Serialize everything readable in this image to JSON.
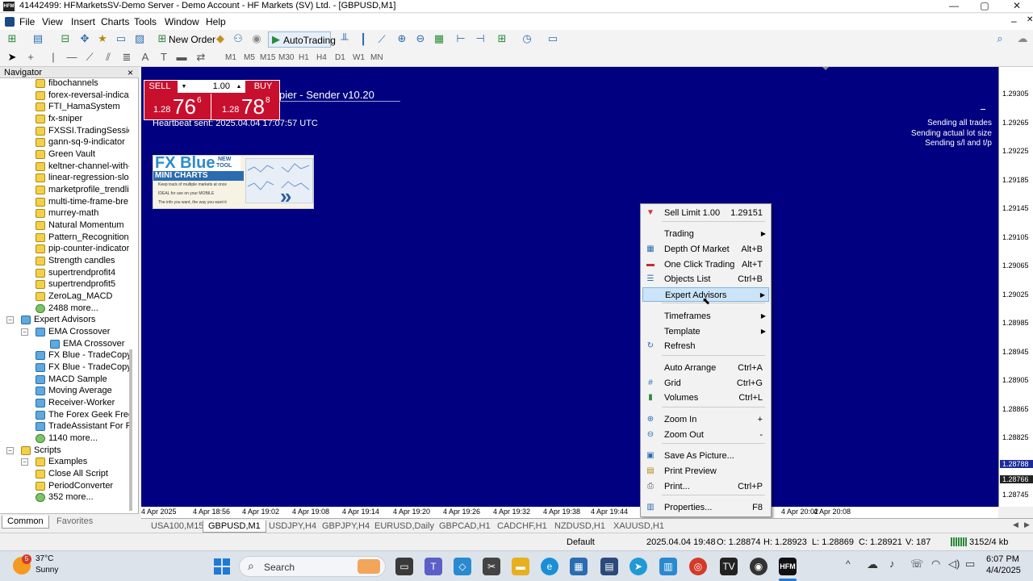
{
  "window": {
    "title": "41442499: HFMarketsSV-Demo Server - Demo Account - HF Markets (SV) Ltd. - [GBPUSD,M1]",
    "app_icon_text": "HFM",
    "minimize": "—",
    "maximize": "▢",
    "close": "✕",
    "inner_minimize": "–",
    "inner_restore": "❐",
    "inner_close": "✕"
  },
  "menu": [
    "File",
    "View",
    "Insert",
    "Charts",
    "Tools",
    "Window",
    "Help"
  ],
  "toolbar": {
    "new_order": "New Order",
    "autotrading": "AutoTrading",
    "timeframes": [
      "M1",
      "M5",
      "M15",
      "M30",
      "H1",
      "H4",
      "D1",
      "W1",
      "MN"
    ]
  },
  "navigator": {
    "title": "Navigator",
    "close": "×",
    "indicators": [
      "fibochannels",
      "forex-reversal-indicat",
      "FTI_HamaSystem",
      "fx-sniper",
      "FXSSI.TradingSessions",
      "gann-sq-9-indicator",
      "Green Vault",
      "keltner-channel-with-",
      "linear-regression-slop",
      "marketprofile_trendlin",
      "multi-time-frame-bre",
      "murrey-math",
      "Natural Momentum",
      "Pattern_Recognition_I",
      "pip-counter-indicator",
      "Strength candles",
      "supertrendprofit4",
      "supertrendprofit5",
      "ZeroLag_MACD"
    ],
    "indicators_more": "2488 more...",
    "experts_folder": "Expert Advisors",
    "experts": [
      {
        "label": "EMA Crossover",
        "level": 1
      },
      {
        "label": "EMA Crossover",
        "level": 2
      },
      {
        "label": "FX Blue - TradeCopy I",
        "level": 1
      },
      {
        "label": "FX Blue - TradeCopy S",
        "level": 1
      },
      {
        "label": "MACD Sample",
        "level": 1
      },
      {
        "label": "Moving Average",
        "level": 1
      },
      {
        "label": "Receiver-Worker",
        "level": 1
      },
      {
        "label": "The Forex Geek Free F",
        "level": 1
      },
      {
        "label": "TradeAssistant For Fre",
        "level": 1
      },
      {
        "label": "1140 more...",
        "level": 1
      }
    ],
    "scripts_folder": "Scripts",
    "scripts": [
      {
        "label": "Examples",
        "level": 1
      },
      {
        "label": "Close All Script",
        "level": 1
      },
      {
        "label": "PeriodConverter",
        "level": 1
      },
      {
        "label": "352 more...",
        "level": 1
      }
    ],
    "tabs": [
      "Common",
      "Favorites"
    ]
  },
  "oneclick": {
    "sell": "SELL",
    "buy": "BUY",
    "lot": "1.00",
    "sell_big": "1.28",
    "sell_pips": "76",
    "sell_sup": "6",
    "buy_big": "1.28",
    "buy_pips": "78",
    "buy_sup": "8"
  },
  "chart": {
    "ea_title": "pier - Sender v10.20",
    "heartbeat": "Heartbeat sent: 2025.04.04 17:07:57 UTC",
    "status_lines": [
      "Sending all trades",
      "Sending actual lot size",
      "Sending s/l and t/p"
    ],
    "banner": {
      "brand": "FX Blue",
      "new": "NEW",
      "tool": "TOOL",
      "subtitle": "MINI CHARTS",
      "bullets": [
        "Keep track of multiple markets at once",
        "IDEAL for use on your MOBILE",
        "The info you want, the way you want it"
      ]
    },
    "price_labels": [
      "1.29305",
      "1.29265",
      "1.29225",
      "1.29185",
      "1.29145",
      "1.29105",
      "1.29065",
      "1.29025",
      "1.28985",
      "1.28945",
      "1.28905",
      "1.28865",
      "1.28825",
      "1.28788",
      "1.28766",
      "1.28745"
    ],
    "highlight_bid": "1.28788",
    "highlight_ask": "1.28766",
    "time_labels": [
      "4 Apr 2025",
      "4 Apr 18:56",
      "4 Apr 19:02",
      "4 Apr 19:08",
      "4 Apr 19:14",
      "4 Apr 19:20",
      "4 Apr 19:26",
      "4 Apr 19:32",
      "4 Apr 19:38",
      "4 Apr 19:44",
      "4 Apr 20:02",
      "4 Apr 20:08"
    ]
  },
  "context_menu": [
    {
      "label": "Sell Limit 1.00",
      "shortcut": "1.29151",
      "icon": "sell-limit-icon",
      "glyph": "▼",
      "color": "#d23030"
    },
    {
      "label": "Trading",
      "submenu": true
    },
    {
      "label": "Depth Of Market",
      "shortcut": "Alt+B",
      "icon": "depth-of-market-icon",
      "glyph": "▦",
      "color": "#2a6db0"
    },
    {
      "label": "One Click Trading",
      "shortcut": "Alt+T",
      "icon": "one-click-trading-icon",
      "glyph": "▬",
      "color": "#c03030"
    },
    {
      "label": "Objects List",
      "shortcut": "Ctrl+B",
      "icon": "objects-list-icon",
      "glyph": "☰",
      "color": "#2a6db0"
    },
    {
      "label": "Expert Advisors",
      "submenu": true,
      "highlight": true
    },
    {
      "label": "Timeframes",
      "submenu": true
    },
    {
      "label": "Template",
      "submenu": true
    },
    {
      "label": "Refresh",
      "icon": "refresh-icon",
      "glyph": "↻",
      "color": "#2a6db0"
    },
    {
      "label": "Auto Arrange",
      "shortcut": "Ctrl+A"
    },
    {
      "label": "Grid",
      "shortcut": "Ctrl+G",
      "icon": "grid-icon",
      "glyph": "#",
      "color": "#2a6db0"
    },
    {
      "label": "Volumes",
      "shortcut": "Ctrl+L",
      "icon": "volumes-icon",
      "glyph": "▮",
      "color": "#2a8a3a"
    },
    {
      "label": "Zoom In",
      "shortcut": "+",
      "icon": "zoom-in-icon",
      "glyph": "⊕",
      "color": "#2a6db0"
    },
    {
      "label": "Zoom Out",
      "shortcut": "-",
      "icon": "zoom-out-icon",
      "glyph": "⊖",
      "color": "#2a6db0"
    },
    {
      "label": "Save As Picture...",
      "icon": "save-picture-icon",
      "glyph": "▣",
      "color": "#2a6db0"
    },
    {
      "label": "Print Preview",
      "icon": "print-preview-icon",
      "glyph": "▤",
      "color": "#b08a10"
    },
    {
      "label": "Print...",
      "shortcut": "Ctrl+P",
      "icon": "print-icon",
      "glyph": "⎙",
      "color": "#555"
    },
    {
      "label": "Properties...",
      "shortcut": "F8",
      "icon": "properties-icon",
      "glyph": "▥",
      "color": "#2a6db0"
    }
  ],
  "chart_tabs": [
    {
      "label": "USA100,M15"
    },
    {
      "label": "GBPUSD,M1",
      "active": true
    },
    {
      "label": "USDJPY,H4"
    },
    {
      "label": "GBPJPY,H4"
    },
    {
      "label": "EURUSD,Daily"
    },
    {
      "label": "GBPCAD,H1"
    },
    {
      "label": "CADCHF,H1"
    },
    {
      "label": "NZDUSD,H1"
    },
    {
      "label": "XAUUSD,H1"
    }
  ],
  "status": {
    "profile": "Default",
    "datetime": "2025.04.04 19:48",
    "open": "O: 1.28874",
    "high": "H: 1.28923",
    "low": "L: 1.28869",
    "close": "C: 1.28921",
    "volume": "V: 187",
    "traffic": "3152/4 kb"
  },
  "taskbar": {
    "weather_temp": "37°C",
    "weather_desc": "Sunny",
    "weather_badge": "5",
    "search": "Search",
    "time": "6:07 PM",
    "date": "4/4/2025"
  }
}
